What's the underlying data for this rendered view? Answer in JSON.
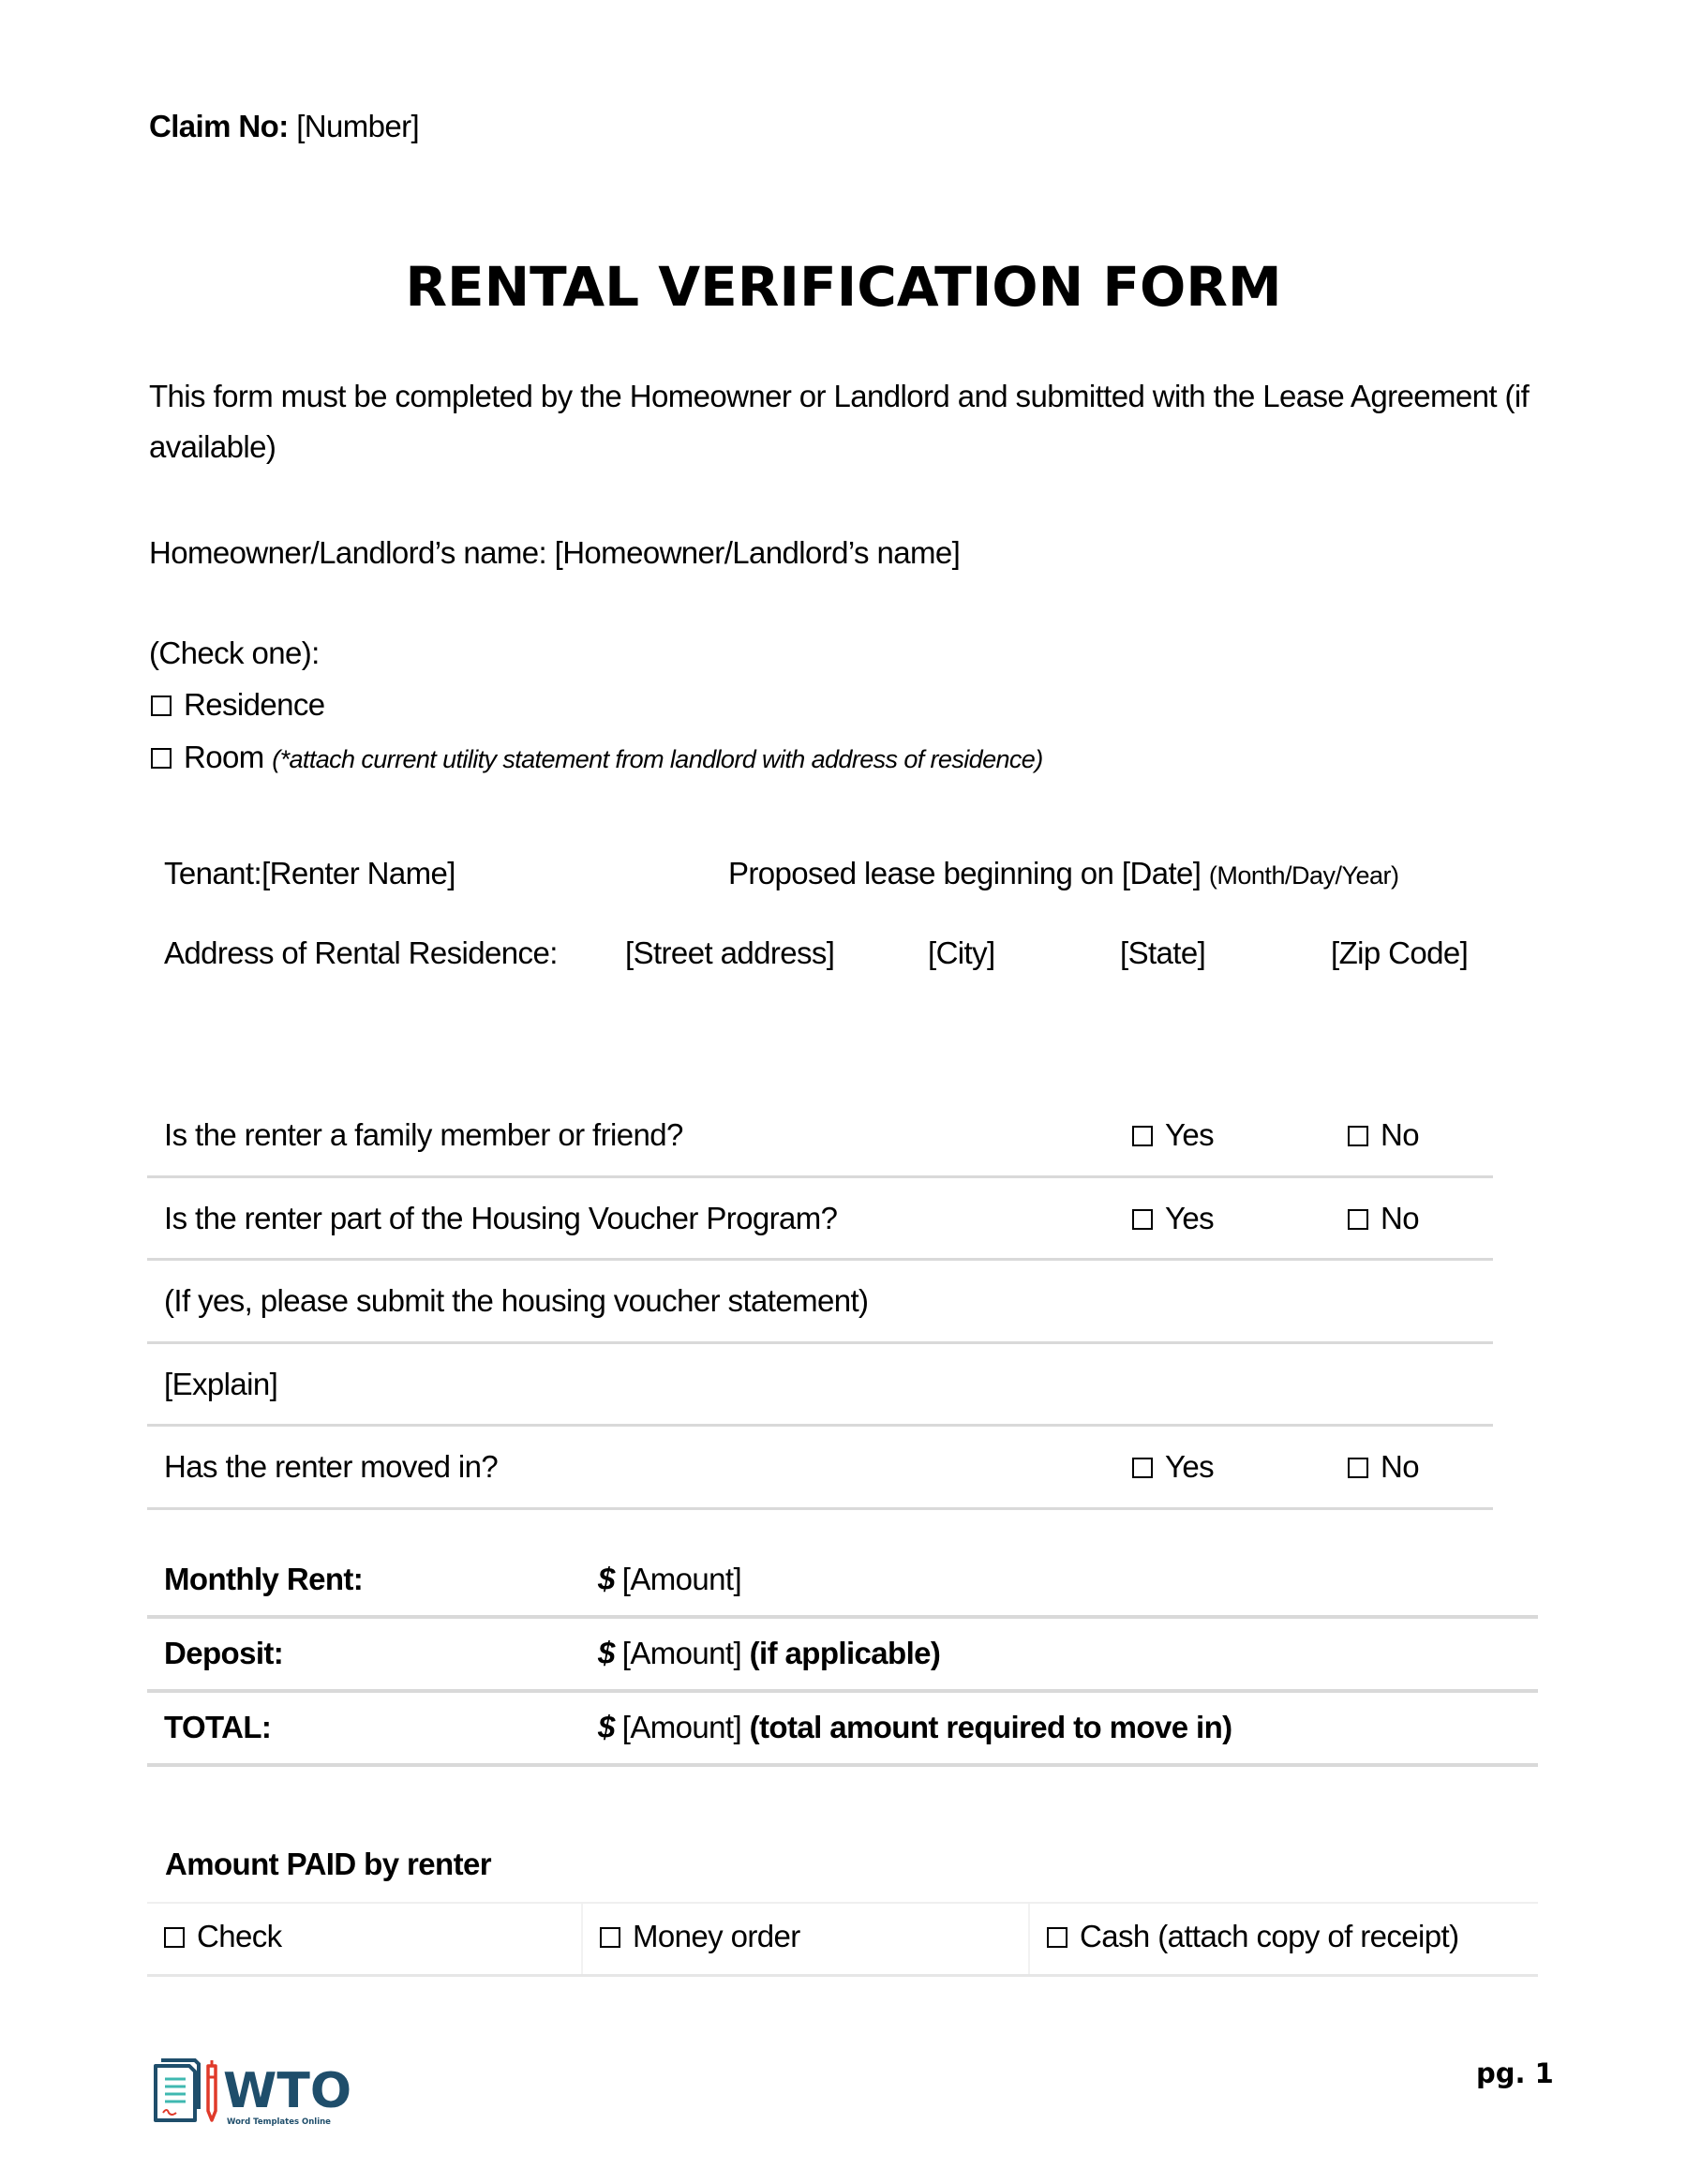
{
  "claim": {
    "label": "Claim No:",
    "value": "[Number]"
  },
  "title": "RENTAL VERIFICATION FORM",
  "intro": "This form must be completed by the Homeowner or Landlord and submitted with the Lease Agreement (if available)",
  "landlord": {
    "label": "Homeowner/Landlord’s name:",
    "value": "[Homeowner/Landlord’s name]"
  },
  "check_one": {
    "label": "(Check one):",
    "options": [
      {
        "label": "Residence",
        "note": "",
        "checked": false
      },
      {
        "label": "Room",
        "note": "(*attach current utility statement from landlord with address of residence)",
        "checked": false
      }
    ]
  },
  "tenant": {
    "label": "Tenant:",
    "value": "[Renter Name]",
    "lease_label": "Proposed lease beginning on",
    "lease_value": "[Date]",
    "lease_format": "(Month/Day/Year)"
  },
  "address": {
    "label": "Address of Rental Residence:",
    "street": "[Street address]",
    "city": "[City]",
    "state": "[State]",
    "zip": "[Zip Code]"
  },
  "questions": [
    {
      "text": "Is the renter a family member or friend?",
      "yes": "Yes",
      "no": "No",
      "has_options": true
    },
    {
      "text": "Is the renter part of the Housing Voucher Program?",
      "yes": "Yes",
      "no": "No",
      "has_options": true
    },
    {
      "text": "(If yes, please submit the housing voucher statement)",
      "has_options": false
    },
    {
      "text": "[Explain]",
      "has_options": false
    },
    {
      "text": "Has the renter moved in?",
      "yes": "Yes",
      "no": "No",
      "has_options": true
    }
  ],
  "money": [
    {
      "label": "Monthly Rent:",
      "currency": "$",
      "value": "[Amount]",
      "note": ""
    },
    {
      "label": "Deposit:",
      "currency": "$",
      "value": "[Amount]",
      "note": "(if applicable)"
    },
    {
      "label": "TOTAL:",
      "currency": "$",
      "value": "[Amount]",
      "note": "(total amount required to move in)"
    }
  ],
  "payment": {
    "title": "Amount PAID by renter",
    "options": [
      {
        "label": "Check",
        "checked": false
      },
      {
        "label": "Money order",
        "checked": false
      },
      {
        "label": "Cash (attach copy of receipt)",
        "checked": false
      }
    ]
  },
  "footer": {
    "logo_text": "WTO",
    "logo_subtext": "Word Templates Online",
    "page": "pg. 1",
    "colors": {
      "logo_navy": "#1f4e6b",
      "logo_teal": "#3fb8b0",
      "logo_red": "#e03a2a"
    }
  }
}
